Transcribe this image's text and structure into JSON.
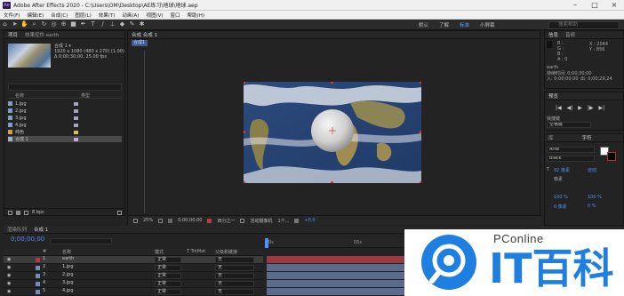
{
  "window": {
    "title": "Adobe After Effects 2020 - C:\\Users\\OM\\Desktop\\AE练习\\地球\\地球.aep",
    "app_icon": "Ae"
  },
  "menu": [
    "文件(F)",
    "编辑(E)",
    "合成(C)",
    "图层(L)",
    "效果(T)",
    "动画(A)",
    "视图(V)",
    "窗口",
    "帮助(H)"
  ],
  "workspaces": [
    "默认",
    "了解",
    "标准",
    "小屏幕"
  ],
  "workspace_search_placeholder": "搜索帮助",
  "project": {
    "tabs": [
      "项目",
      "效果控件 earth"
    ],
    "comp_name": "合成 1 ▾",
    "comp_info": [
      "1920 x 1080 (480 x 270) (1.00)",
      "Δ 0;00;30;00, 25.00 fps"
    ],
    "col_name": "名称",
    "col_label": "类型",
    "items": [
      "1.jpg",
      "2.jpg",
      "3.jpg",
      "4.jpg",
      "纯色",
      "合成 1"
    ],
    "bpc": "8 bpc"
  },
  "viewer": {
    "tabs": [
      "合成 合成 1"
    ],
    "comp_tab": "合成1",
    "zoom": "25%",
    "timecode": "0;00;00;00",
    "resolution": "四分之一",
    "camera": "活动摄像机",
    "views": "1个...",
    "offset": "+0.0"
  },
  "info": {
    "tabs": [
      "信息",
      "音频"
    ],
    "r": "R :",
    "g": "G :",
    "b": "B :",
    "a": "A : 0",
    "x": "X : 2044",
    "y": "Y : 856",
    "layer": "earth",
    "duration": "持续时间: 0;00;30;00",
    "in": "入: 0;00;00;00",
    "out": "出: 0;00;29;24"
  },
  "preview": {
    "tab": "预览",
    "shortcut_label": "快捷键",
    "shortcut_value": "空格键"
  },
  "character": {
    "tabs": [
      "库",
      "字符"
    ],
    "font": "Arial",
    "style": "Black",
    "size": "92 像素",
    "leading": "自动",
    "tracking": "像素",
    "vscale": "100 %",
    "hscale": "100 %",
    "baseline": "0 像素",
    "tsume": "0 %"
  },
  "timeline": {
    "tabs": [
      "渲染队列",
      "合成 1"
    ],
    "timecode": "0;00;00;00",
    "cols": [
      "#",
      "名称",
      "模式",
      "T TrkMat",
      "父级和链接"
    ],
    "layers": [
      {
        "num": "1",
        "name": "earth",
        "mode": "正常",
        "parent": "无",
        "color": "#b8363d"
      },
      {
        "num": "2",
        "name": "1.jpg",
        "mode": "正常",
        "parent": "无",
        "color": "#6f8fb8"
      },
      {
        "num": "3",
        "name": "2.jpg",
        "mode": "正常",
        "parent": "无",
        "color": "#6f8fb8"
      },
      {
        "num": "4",
        "name": "3.jpg",
        "mode": "正常",
        "parent": "无",
        "color": "#6f8fb8"
      },
      {
        "num": "5",
        "name": "4.jpg",
        "mode": "正常",
        "parent": "无",
        "color": "#6f8fb8"
      }
    ],
    "ruler": [
      "0s",
      "05s",
      "10s"
    ],
    "bar_colors": [
      "#9a3a43",
      "#5b6b8b",
      "#5b6b8b",
      "#5b6b8b",
      "#5b6b8b"
    ]
  },
  "watermark": {
    "top": "PConline",
    "big": "IT百科"
  },
  "colors": {
    "accent": "#4f8fff",
    "watermark_blue": "#1f7fe0"
  }
}
